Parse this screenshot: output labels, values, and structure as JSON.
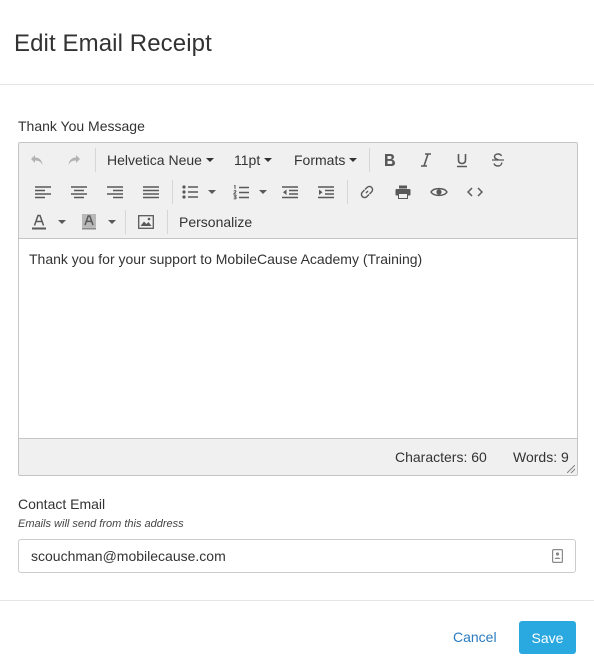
{
  "dialog": {
    "title": "Edit Email Receipt"
  },
  "message": {
    "label": "Thank You Message",
    "toolbar": {
      "font_family": "Helvetica Neue",
      "font_size": "11pt",
      "formats": "Formats",
      "personalize": "Personalize"
    },
    "body_text": "Thank you for your support to MobileCause Academy (Training)",
    "status": {
      "characters": "Characters: 60",
      "words": "Words: 9"
    }
  },
  "contact_email": {
    "label": "Contact Email",
    "help": "Emails will send from this address",
    "value": "scouchman@mobilecause.com"
  },
  "footer": {
    "cancel_label": "Cancel",
    "save_label": "Save"
  },
  "colors": {
    "accent": "#2aa8e0",
    "link": "#2a7bbf",
    "toolbar_bg": "#f0f0f0"
  }
}
